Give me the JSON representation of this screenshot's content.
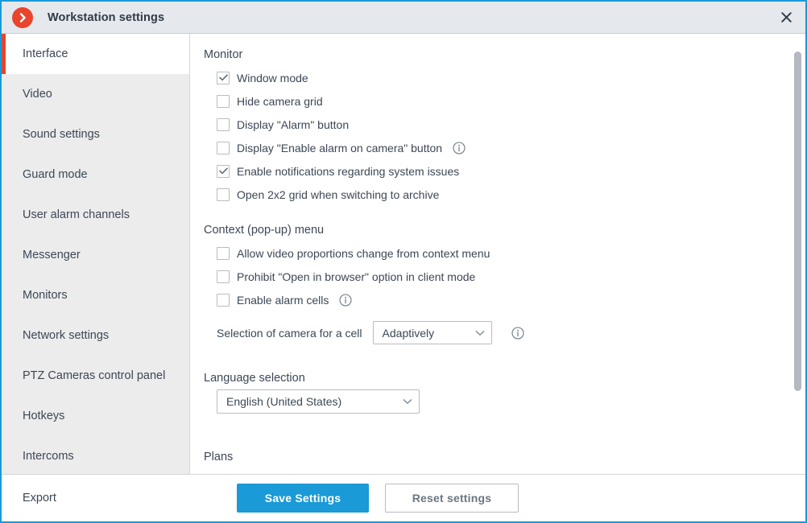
{
  "window": {
    "title": "Workstation settings",
    "app_icon": "chevron-right-circle-icon",
    "close_icon": "close-icon",
    "accent_color": "#1a9ad7",
    "brand_color": "#e8452c"
  },
  "sidebar": {
    "items": [
      {
        "label": "Interface",
        "active": true
      },
      {
        "label": "Video",
        "active": false
      },
      {
        "label": "Sound settings",
        "active": false
      },
      {
        "label": "Guard mode",
        "active": false
      },
      {
        "label": "User alarm channels",
        "active": false
      },
      {
        "label": "Messenger",
        "active": false
      },
      {
        "label": "Monitors",
        "active": false
      },
      {
        "label": "Network settings",
        "active": false
      },
      {
        "label": "PTZ Cameras control panel",
        "active": false
      },
      {
        "label": "Hotkeys",
        "active": false
      },
      {
        "label": "Intercoms",
        "active": false
      }
    ]
  },
  "main": {
    "monitor": {
      "title": "Monitor",
      "options": [
        {
          "label": "Window mode",
          "checked": true,
          "info": false
        },
        {
          "label": "Hide camera grid",
          "checked": false,
          "info": false
        },
        {
          "label": "Display \"Alarm\" button",
          "checked": false,
          "info": false
        },
        {
          "label": "Display \"Enable alarm on camera\" button",
          "checked": false,
          "info": true
        },
        {
          "label": "Enable notifications regarding system issues",
          "checked": true,
          "info": false
        },
        {
          "label": "Open 2x2 grid when switching to archive",
          "checked": false,
          "info": false
        }
      ]
    },
    "context_menu": {
      "title": "Context (pop-up) menu",
      "options": [
        {
          "label": "Allow video proportions change from context menu",
          "checked": false,
          "info": false
        },
        {
          "label": "Prohibit \"Open in browser\" option in client mode",
          "checked": false,
          "info": false
        },
        {
          "label": "Enable alarm cells",
          "checked": false,
          "info": true
        }
      ],
      "camera_selection": {
        "label": "Selection of camera for a cell",
        "value": "Adaptively",
        "info": true
      }
    },
    "language": {
      "title": "Language selection",
      "value": "English (United States)"
    },
    "plans": {
      "title": "Plans"
    }
  },
  "footer": {
    "export_label": "Export",
    "save_label": "Save Settings",
    "reset_label": "Reset settings"
  }
}
